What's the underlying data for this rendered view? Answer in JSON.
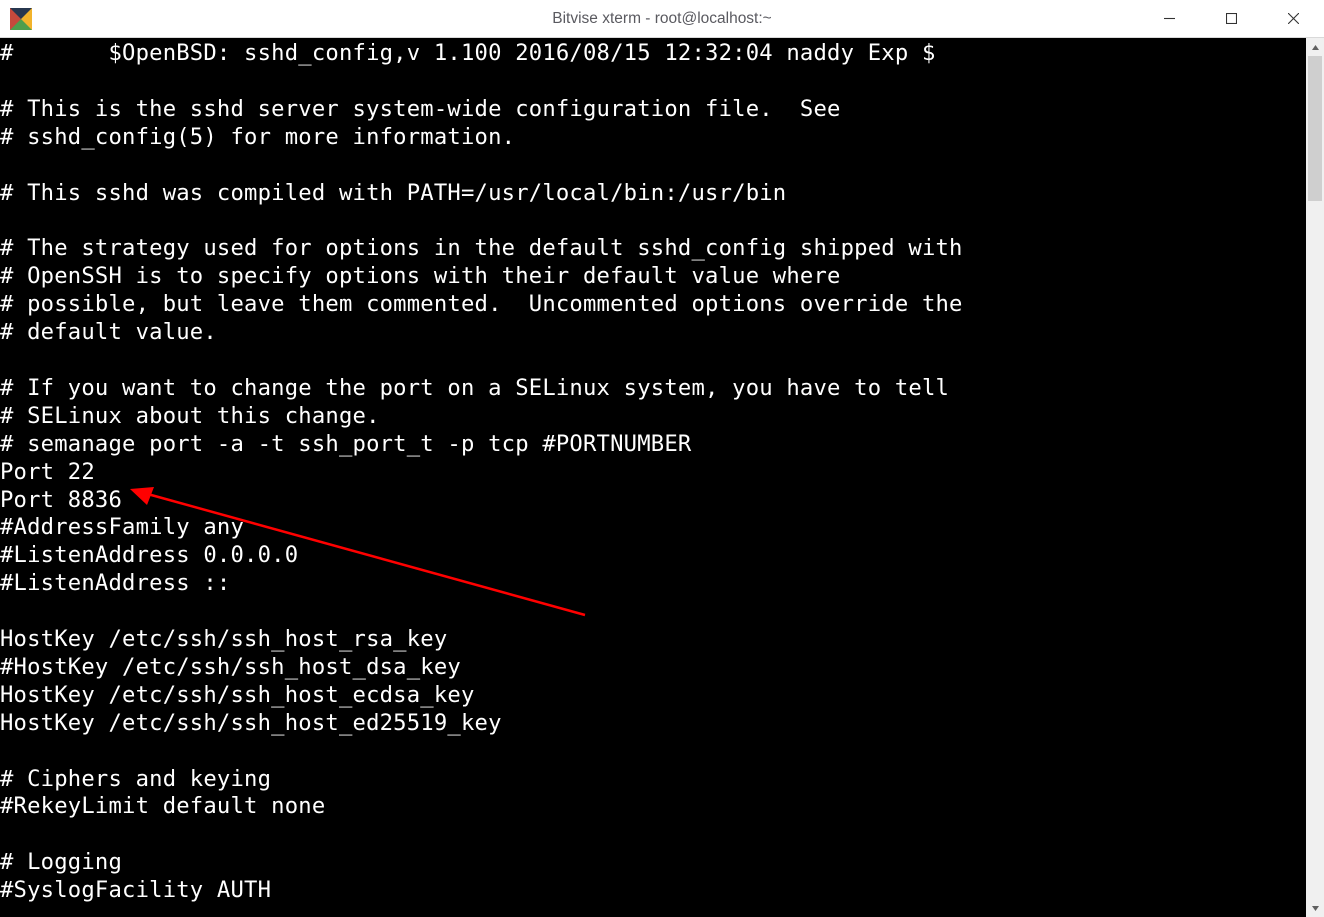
{
  "window": {
    "title": "Bitvise xterm - root@localhost:~"
  },
  "controls": {
    "minimize": "minimize",
    "maximize": "maximize",
    "close": "close"
  },
  "terminal": {
    "lines": [
      "#       $OpenBSD: sshd_config,v 1.100 2016/08/15 12:32:04 naddy Exp $",
      "",
      "# This is the sshd server system-wide configuration file.  See",
      "# sshd_config(5) for more information.",
      "",
      "# This sshd was compiled with PATH=/usr/local/bin:/usr/bin",
      "",
      "# The strategy used for options in the default sshd_config shipped with",
      "# OpenSSH is to specify options with their default value where",
      "# possible, but leave them commented.  Uncommented options override the",
      "# default value.",
      "",
      "# If you want to change the port on a SELinux system, you have to tell",
      "# SELinux about this change.",
      "# semanage port -a -t ssh_port_t -p tcp #PORTNUMBER",
      "Port 22",
      "Port 8836",
      "#AddressFamily any",
      "#ListenAddress 0.0.0.0",
      "#ListenAddress ::",
      "",
      "HostKey /etc/ssh/ssh_host_rsa_key",
      "#HostKey /etc/ssh/ssh_host_dsa_key",
      "HostKey /etc/ssh/ssh_host_ecdsa_key",
      "HostKey /etc/ssh/ssh_host_ed25519_key",
      "",
      "# Ciphers and keying",
      "#RekeyLimit default none",
      "",
      "# Logging",
      "#SyslogFacility AUTH"
    ]
  }
}
